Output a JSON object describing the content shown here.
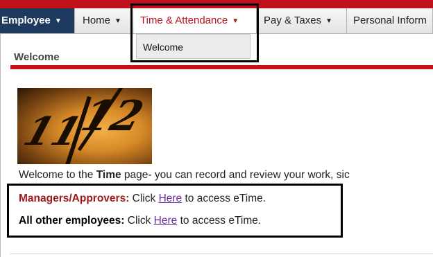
{
  "nav": {
    "employee_label": "Employee",
    "home_label": "Home",
    "time_label": "Time & Attendance",
    "pay_label": "Pay & Taxes",
    "personal_label": "Personal Inform"
  },
  "dropdown": {
    "welcome_label": "Welcome"
  },
  "page": {
    "header": "Welcome",
    "intro_prefix": "Welcome to the ",
    "intro_bold": "Time",
    "intro_suffix": " page- you can record and review your work, sic"
  },
  "access": {
    "managers_label": "Managers/Approvers:",
    "managers_click": " Click ",
    "managers_link": "Here",
    "managers_suffix": " to access eTime.",
    "employees_label": "All other employees:",
    "employees_click": " Click ",
    "employees_link": "Here",
    "employees_suffix": " to access eTime."
  },
  "colors": {
    "brand_red": "#c1121b",
    "nav_active": "#1f3a5f",
    "link_purple": "#6a2ba2"
  },
  "icons": {
    "caret": "caret-down-icon"
  }
}
